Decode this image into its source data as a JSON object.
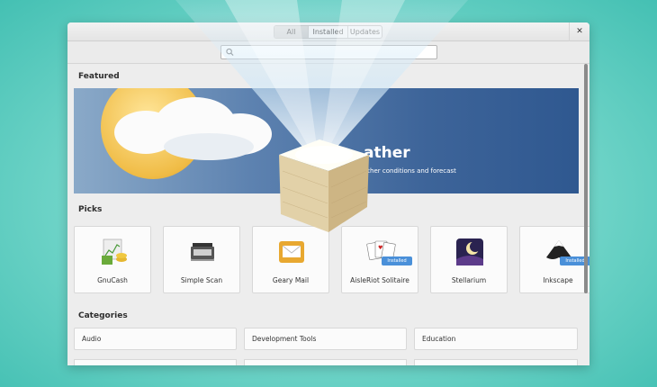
{
  "tabs": [
    {
      "label": "All",
      "active": true
    },
    {
      "label": "Installed",
      "active": false
    },
    {
      "label": "Updates",
      "active": false
    }
  ],
  "search": {
    "placeholder": "",
    "value": ""
  },
  "sections": {
    "featured": "Featured",
    "picks": "Picks",
    "categories": "Categories"
  },
  "featured": {
    "title": "ather",
    "subtitle": "ather conditions and forecast"
  },
  "picks": [
    {
      "label": "GnuCash",
      "icon": "gnucash-icon"
    },
    {
      "label": "Simple Scan",
      "icon": "scanner-icon"
    },
    {
      "label": "Geary Mail",
      "icon": "mail-icon"
    },
    {
      "label": "AisleRiot Solitaire",
      "icon": "cards-icon",
      "badge": "Installed"
    },
    {
      "label": "Stellarium",
      "icon": "night-sky-icon"
    },
    {
      "label": "Inkscape",
      "icon": "inkscape-icon",
      "badge": "Installed"
    }
  ],
  "categories": [
    {
      "label": "Audio"
    },
    {
      "label": "Development Tools"
    },
    {
      "label": "Education"
    }
  ],
  "colors": {
    "background": "#44c0b3",
    "accent": "#4a90d9",
    "banner": "#3d6499"
  }
}
